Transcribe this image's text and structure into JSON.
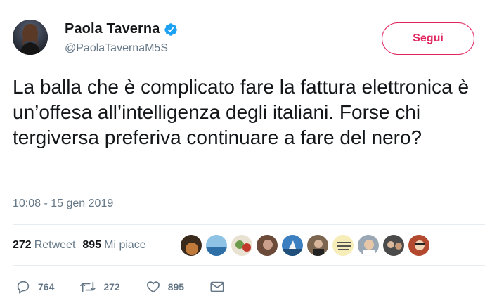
{
  "user": {
    "display_name": "Paola Taverna",
    "handle": "@PaolaTavernaM5S",
    "verified": true
  },
  "follow_button": {
    "label": "Segui"
  },
  "tweet": {
    "text": "La balla che è complicato fare la fattura elettronica è un’offesa all’intelligenza degli italiani. Forse chi tergiversa preferiva continuare a fare del nero?",
    "timestamp": "10:08 - 15 gen 2019"
  },
  "stats": {
    "retweets_count": "272",
    "retweets_label": "Retweet",
    "likes_count": "895",
    "likes_label": "Mi piace"
  },
  "actions": {
    "reply_count": "764",
    "retweet_count": "272",
    "like_count": "895"
  },
  "colors": {
    "accent": "#e0245e",
    "verified": "#1da1f2",
    "muted": "#657786",
    "text": "#14171a"
  },
  "icons": {
    "verified": "verified-badge-icon",
    "reply": "reply-icon",
    "retweet": "retweet-icon",
    "like": "heart-icon",
    "dm": "envelope-icon"
  }
}
